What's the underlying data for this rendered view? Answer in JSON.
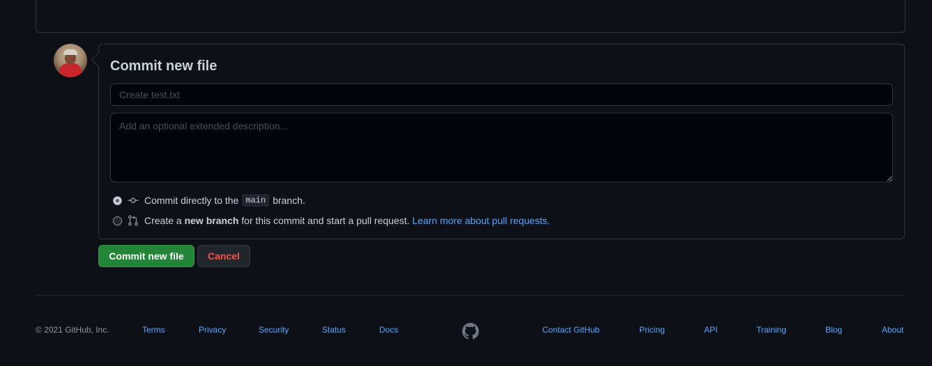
{
  "commit_form": {
    "title": "Commit new file",
    "summary_placeholder": "Create test.txt",
    "description_placeholder": "Add an optional extended description...",
    "option_direct": {
      "prefix": "Commit directly to the",
      "branch": "main",
      "suffix": "branch."
    },
    "option_new_branch": {
      "prefix": "Create a",
      "bold": "new branch",
      "suffix": "for this commit and start a pull request.",
      "link": "Learn more about pull requests."
    },
    "selected_option": "direct",
    "commit_button": "Commit new file",
    "cancel_button": "Cancel"
  },
  "footer": {
    "copyright": "© 2021 GitHub, Inc.",
    "left_links": [
      "Terms",
      "Privacy",
      "Security",
      "Status",
      "Docs"
    ],
    "right_links": [
      "Contact GitHub",
      "Pricing",
      "API",
      "Training",
      "Blog",
      "About"
    ]
  },
  "icons": {
    "avatar": "user-avatar",
    "commit": "git-commit-icon",
    "pull_request": "git-pull-request-icon",
    "logo": "github-mark-icon"
  },
  "colors": {
    "background": "#0d1117",
    "border": "#30363d",
    "primary_button": "#238636",
    "danger_text": "#f85149",
    "link": "#58a6ff"
  }
}
